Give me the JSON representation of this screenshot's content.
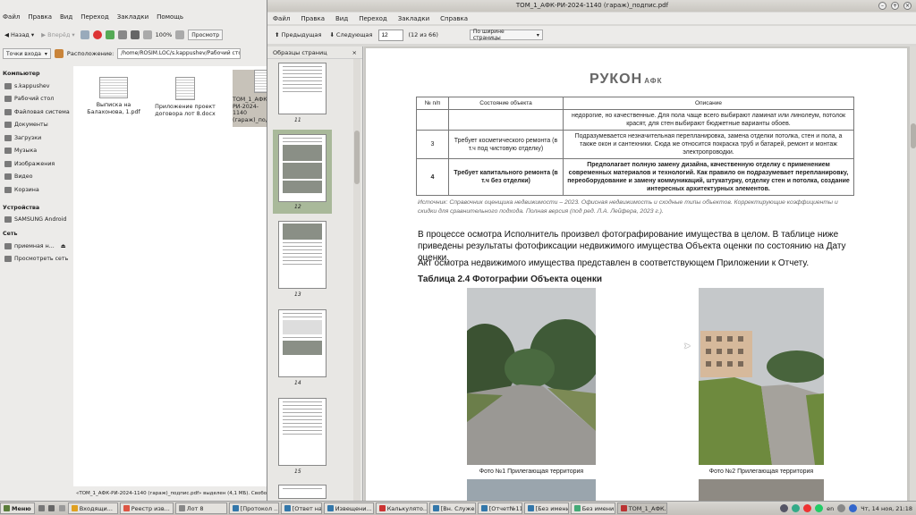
{
  "file_manager": {
    "menu": [
      "Файл",
      "Правка",
      "Вид",
      "Переход",
      "Закладки",
      "Помощь"
    ],
    "toolbar": {
      "back": "Назад",
      "forward": "Вперёд",
      "zoom": "100%",
      "view": "Просмотр"
    },
    "location_label": "Расположение:",
    "entry_points": "Точки входа",
    "location_path": "/home/ROSIM.LOC/s.kappushev/Рабочий стол",
    "sidebar": {
      "computer_header": "Компьютер",
      "computer_items": [
        "s.kappushev",
        "Рабочий стол",
        "Файловая система",
        "Документы",
        "Загрузки",
        "Музыка",
        "Изображения",
        "Видео",
        "Корзина"
      ],
      "devices_header": "Устройства",
      "devices_items": [
        "SAMSUNG Android"
      ],
      "network_header": "Сеть",
      "network_items": [
        "приемная н...",
        "Просмотреть сеть"
      ]
    },
    "files": [
      {
        "name": "Выписка на Балахонова, 1.pdf"
      },
      {
        "name": "Приложение проект договора лот 8.docx"
      },
      {
        "name": "ТОМ_1_АФК-РИ-2024-1140 (гараж)_подпис.pdf"
      }
    ],
    "status": "«ТОМ_1_АФК-РИ-2024-1140 (гараж)_подпис.pdf» выделен (4,1 МБ). Свободное место: 162,2 ГБ"
  },
  "pdf_viewer": {
    "title": "ТОМ_1_АФК-РИ-2024-1140 (гараж)_подпис.pdf",
    "menu": [
      "Файл",
      "Правка",
      "Вид",
      "Переход",
      "Закладки",
      "Справка"
    ],
    "toolbar": {
      "prev": "Предыдущая",
      "next": "Следующая",
      "page_value": "12",
      "page_of": "(12 из 66)",
      "zoom_mode": "По ширине страницы"
    },
    "side_panel": {
      "title": "Образцы страниц",
      "labels": [
        "11",
        "12",
        "13",
        "14",
        "15"
      ],
      "selected": "12"
    },
    "page": {
      "logo": "РУКОН",
      "logo_sub": "АФК",
      "table": {
        "headers": [
          "№ п/п",
          "Состояние объекта",
          "Описание"
        ],
        "row0_desc": "недорогие, но качественные. Для пола чаще всего выбирают ламинат или линолеум, потолок красят, для стен выбирают бюджетные варианты обоев.",
        "row1": {
          "num": "3",
          "state": "Требует косметического ремонта (в т.ч под чистовую отделку)",
          "desc": "Подразумевается незначительная перепланировка, замена отделки потолка, стен и пола, а также окон и сантехники. Сюда же относится покраска труб и батарей, ремонт и монтаж электропроводки."
        },
        "row2": {
          "num": "4",
          "state": "Требует капитального ремонта (в т.ч без отделки)",
          "desc": "Предполагает полную замену дизайна, качественную отделку с применением современных материалов и технологий. Как правило он подразумевает перепланировку, переоборудование и замену коммуникаций, штукатурку, отделку стен и потолка, создание интересных архитектурных элементов."
        }
      },
      "source_note": "Источник: Справочник оценщика недвижимости – 2023. Офисная недвижимость и сходные типы объектов. Корректирующие коэффициенты и скидки для сравнительного подхода. Полная версия (под ред. Л.А. Лейфера, 2023 г.).",
      "para1": "В процессе осмотра Исполнитель произвел фотографирование имущества в целом. В таблице ниже приведены результаты фотофиксации недвижимого имущества Объекта оценки по состоянию на Дату оценки.",
      "para2": "Акт осмотра недвижимого имущества представлен в соответствующем Приложении к Отчету.",
      "table_title": "Таблица 2.4 Фотографии Объекта оценки",
      "caption1": "Фото №1 Прилегающая территория",
      "caption2": "Фото №2 Прилегающая территория"
    }
  },
  "taskbar": {
    "start": "Меню",
    "tasks": [
      "Входящи...",
      "Реестр изв...",
      "Лот 8",
      "[Протокол ...",
      "[Ответ на ...",
      "Извещени...",
      "Калькулято...",
      "[Вн. Служе...",
      "[Отчет№11...",
      "[Без имени...",
      "Без имени ...",
      "ТОМ_1_АФК..."
    ],
    "lang": "en",
    "clock": "Чт, 14 ноя, 21:18"
  }
}
